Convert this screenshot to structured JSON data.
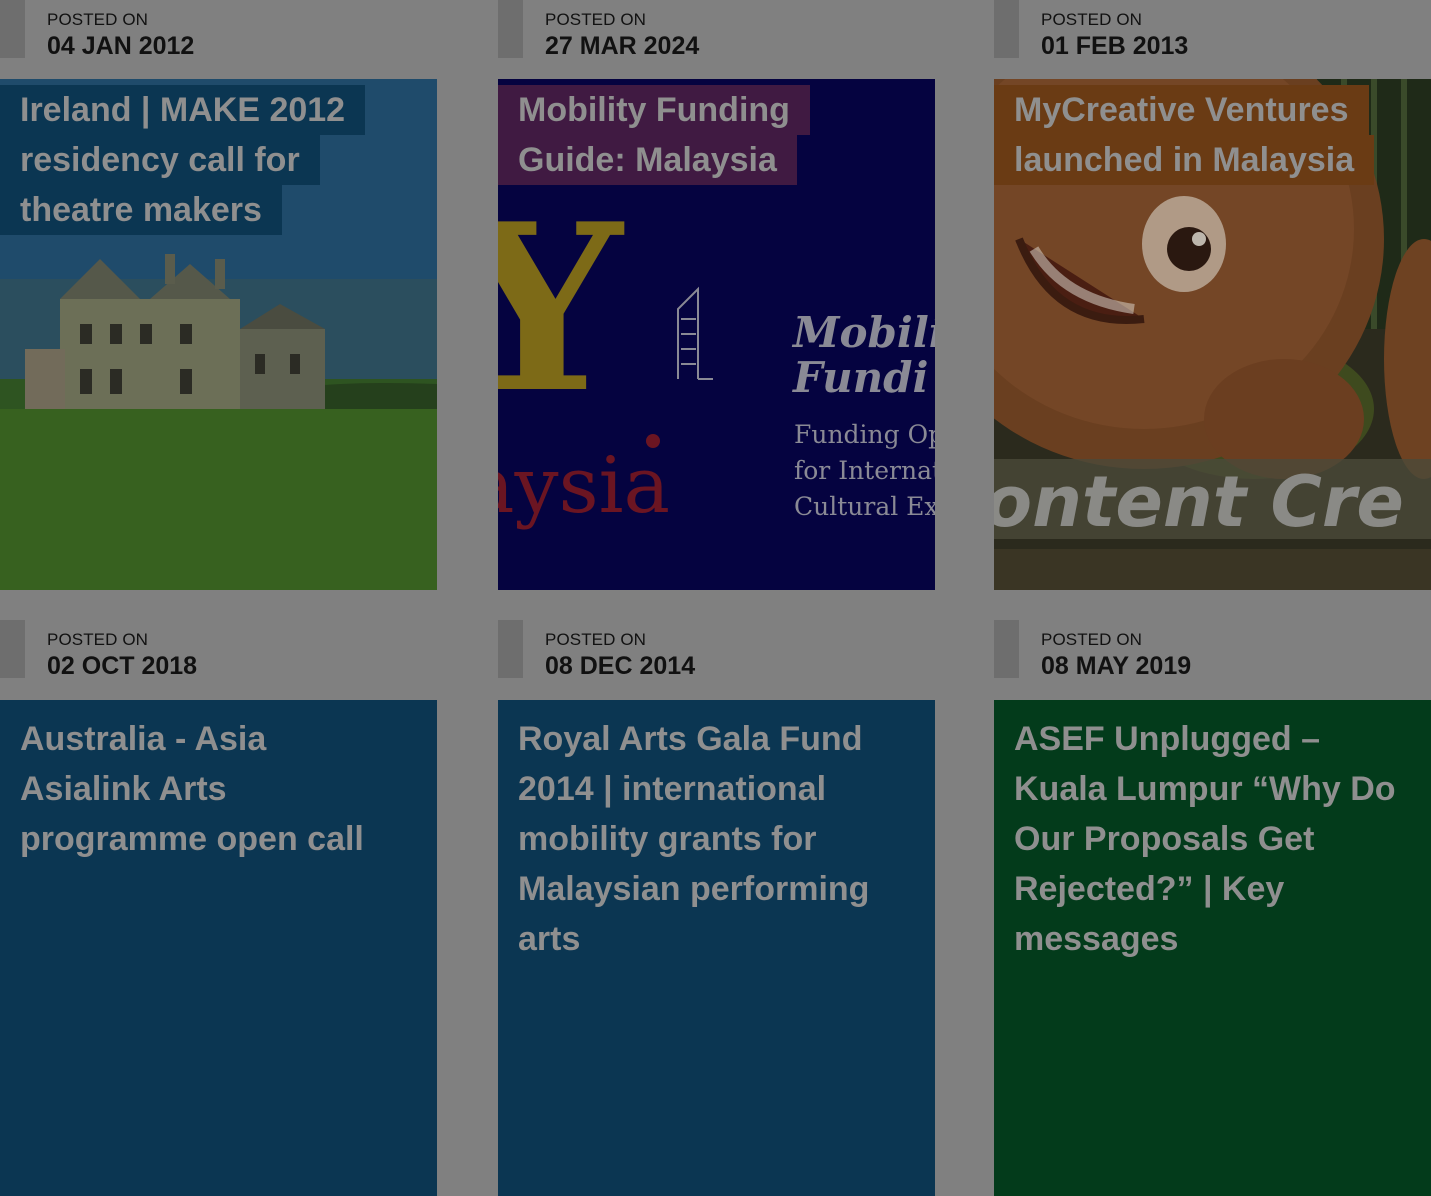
{
  "posts": [
    {
      "posted_label": "POSTED ON",
      "date": "04 JAN 2012",
      "title_lines": [
        "Ireland | MAKE 2012",
        "residency call for",
        "theatre makers"
      ],
      "title_bg": "#0b3652",
      "image": "castle-in-field-photo"
    },
    {
      "posted_label": "POSTED ON",
      "date": "27 MAR 2024",
      "title_lines": [
        "Mobility Funding",
        "Guide: Malaysia"
      ],
      "title_bg": "#401a42",
      "image": "mobility-funding-guide-cover",
      "image_text": {
        "big_letter": "Y",
        "word": "aysia",
        "heading_1": "Mobili",
        "heading_2": "Fundi",
        "sub_1": "Funding Op",
        "sub_2": "for Internat",
        "sub_3": "Cultural Ex"
      }
    },
    {
      "posted_label": "POSTED ON",
      "date": "01 FEB 2013",
      "title_lines": [
        "MyCreative Ventures",
        "launched in Malaysia"
      ],
      "title_bg": "#6a3b14",
      "image": "animated-character-photo",
      "image_text": {
        "banner": "ontent Cre"
      }
    },
    {
      "posted_label": "POSTED ON",
      "date": "02 OCT 2018",
      "title_lines": [
        "Australia - Asia",
        "Asialink Arts",
        "programme open call"
      ],
      "panel_bg": "#0b3652"
    },
    {
      "posted_label": "POSTED ON",
      "date": "08 DEC 2014",
      "title_lines": [
        "Royal Arts Gala Fund",
        "2014 | international",
        "mobility grants for",
        "Malaysian performing",
        "arts"
      ],
      "panel_bg": "#0b3652"
    },
    {
      "posted_label": "POSTED ON",
      "date": "08 MAY 2019",
      "title_lines": [
        "ASEF Unplugged –",
        "Kuala Lumpur “Why Do",
        "Our Proposals Get",
        "Rejected?” | Key",
        "messages"
      ],
      "panel_bg": "#033b1b"
    }
  ]
}
